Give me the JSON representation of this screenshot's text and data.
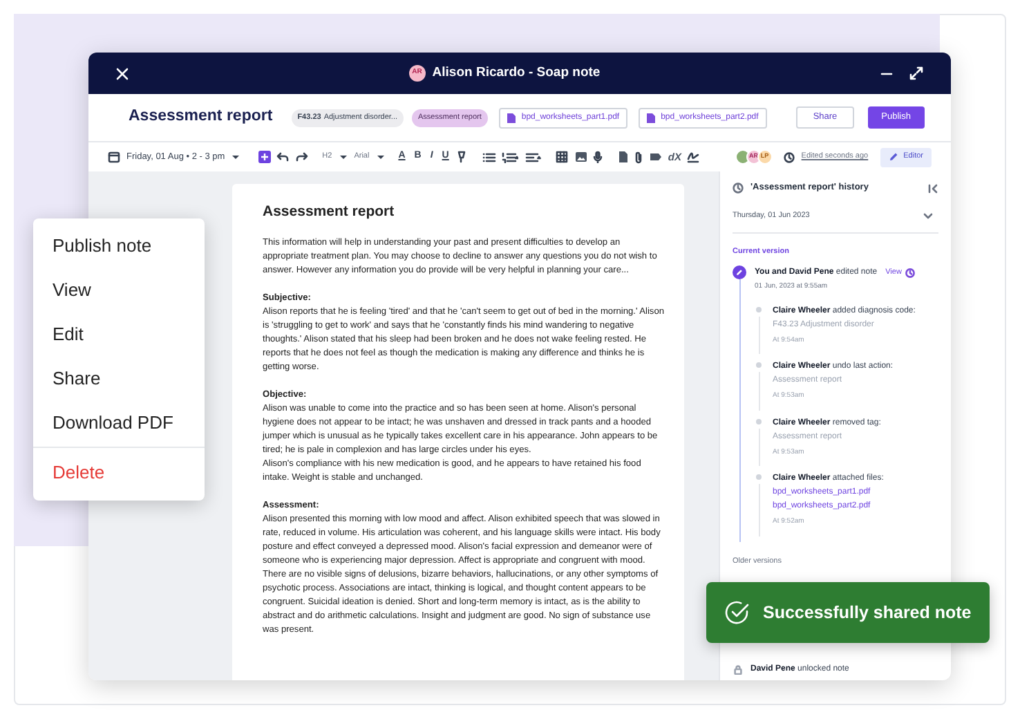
{
  "window": {
    "title": "Alison Ricardo - Soap note",
    "avatar": "AR"
  },
  "header": {
    "title": "Assessment report",
    "tags": [
      {
        "kind": "diagnosis",
        "code": "F43.23",
        "text": "Adjustment disorder..."
      },
      {
        "kind": "tag",
        "text": "Assessment report"
      }
    ],
    "files": [
      "bpd_worksheets_part1.pdf",
      "bpd_worksheets_part2.pdf"
    ],
    "buttons": [
      {
        "kind": "secondary",
        "label": "Share"
      },
      {
        "kind": "primary",
        "label": "Publish"
      }
    ]
  },
  "toolbar": {
    "date": "Friday, 01 Aug • 2 - 3 pm",
    "heading": "H2",
    "font": "Arial",
    "format": [
      "A",
      "B",
      "I",
      "U"
    ],
    "clear": "dX",
    "avatars": [
      "AR",
      "LP"
    ],
    "edited": "Edited seconds ago",
    "mode": "Editor"
  },
  "document": {
    "title": "Assessment report",
    "intro": "This information will help in understanding your past and present difficulties to develop an appropriate treatment plan. You may choose to decline to answer any questions you do not wish to answer. However any information you do provide will be very helpful in planning your care...",
    "sections": [
      {
        "heading": "Subjective:",
        "paragraphs": [
          "Alison reports that he is feeling 'tired' and that he 'can't seem to get out of bed in the morning.' Alison is 'struggling to get to work' and says that he 'constantly finds his mind wandering to negative thoughts.' Alison stated that his sleep had been broken and he does not wake feeling rested. He reports that he does not feel as though the medication is making any difference and thinks he is getting worse."
        ]
      },
      {
        "heading": "Objective:",
        "paragraphs": [
          "Alison was unable to come into the practice and so has been seen at home. Alison's personal hygiene does not appear to be intact; he was unshaven and dressed in track pants and a hooded jumper which is unusual as he typically takes excellent care in his appearance. John appears to be tired; he is pale in complexion and has large circles under his eyes.",
          "Alison's compliance with his new medication is good, and he appears to have retained his food intake. Weight is stable and unchanged."
        ]
      },
      {
        "heading": "Assessment:",
        "paragraphs": [
          "Alison presented this morning with low mood and affect. Alison exhibited speech that was slowed in rate, reduced in volume. His articulation was coherent, and his language skills were intact. His body posture and effect conveyed a depressed mood. Alison's facial expression and demeanor were of someone who is experiencing major depression. Affect is appropriate and congruent with mood. There are no visible signs of delusions, bizarre behaviors, hallucinations, or any other symptoms of psychotic process. Associations are intact, thinking is logical, and thought content appears to be congruent. Suicidal ideation is denied. Short and long-term memory is intact, as is the ability to abstract and do arithmetic calculations. Insight and judgment are good. No sign of substance use was present."
        ]
      }
    ]
  },
  "history": {
    "title": "'Assessment report' history",
    "date": "Thursday, 01 Jun 2023",
    "current_label": "Current version",
    "current": {
      "actor": "You and David Pene",
      "action": "edited note",
      "view": "View",
      "time": "01 Jun, 2023 at 9:55am"
    },
    "events": [
      {
        "actor": "Claire Wheeler",
        "action": "added diagnosis code:",
        "details": [
          {
            "kind": "plain",
            "text": "F43.23 Adjustment disorder"
          }
        ],
        "time": "At 9:54am"
      },
      {
        "actor": "Claire Wheeler",
        "action": "undo last action:",
        "details": [
          {
            "kind": "plain",
            "text": "Assessment report"
          }
        ],
        "time": "At 9:53am"
      },
      {
        "actor": "Claire Wheeler",
        "action": "removed tag:",
        "details": [
          {
            "kind": "plain",
            "text": "Assessment report"
          }
        ],
        "time": "At 9:53am"
      },
      {
        "actor": "Claire Wheeler",
        "action": "attached files:",
        "details": [
          {
            "kind": "link",
            "text": "bpd_worksheets_part1.pdf"
          },
          {
            "kind": "link",
            "text": "bpd_worksheets_part2.pdf"
          }
        ],
        "time": "At 9:52am"
      }
    ],
    "older_label": "Older versions",
    "older": [
      {
        "kind": "lock",
        "actor": "David Pene",
        "action": "unlocked note"
      }
    ]
  },
  "menu": [
    {
      "kind": "normal",
      "label": "Publish note"
    },
    {
      "kind": "normal",
      "label": "View"
    },
    {
      "kind": "normal",
      "label": "Edit"
    },
    {
      "kind": "normal",
      "label": "Share"
    },
    {
      "kind": "normal",
      "label": "Download PDF"
    },
    {
      "kind": "danger",
      "label": "Delete"
    }
  ],
  "toast": {
    "message": "Successfully shared note"
  }
}
